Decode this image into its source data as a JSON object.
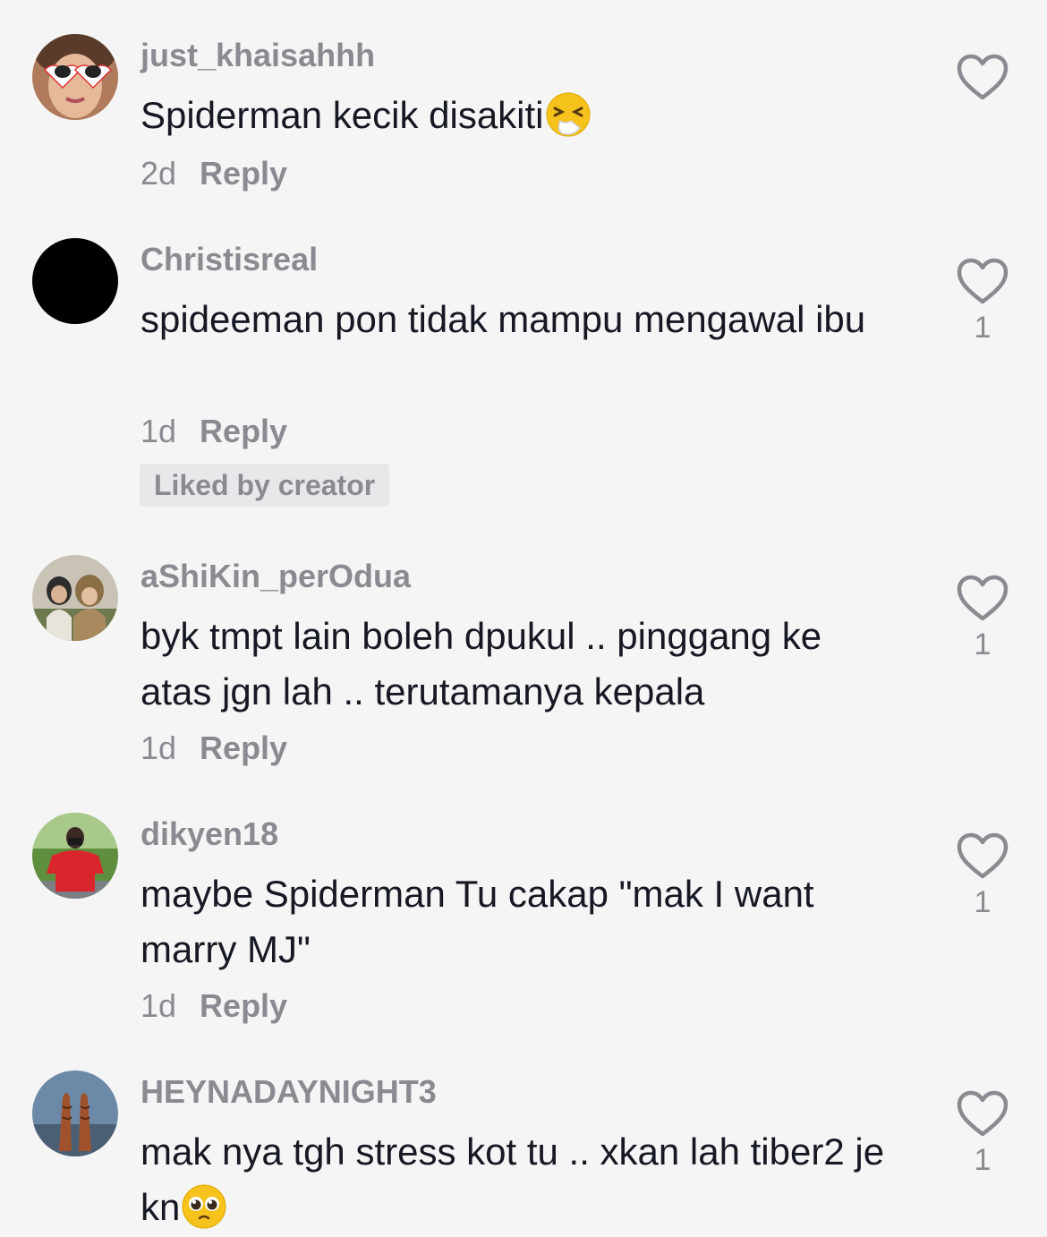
{
  "comments": [
    {
      "username": "just_khaisahhh",
      "text": "Spiderman kecik disakiti",
      "emoji": "sneezing-face-emoji",
      "time": "2d",
      "reply_label": "Reply",
      "like_count": "",
      "avatar_icon": "avatar-heart-sunglasses"
    },
    {
      "username": "Christisreal",
      "text": "spideeman pon tidak mampu mengawal ibu",
      "emoji": "",
      "time": "1d",
      "reply_label": "Reply",
      "like_count": "1",
      "liked_by_creator": "Liked by creator",
      "avatar_icon": "avatar-black-circle"
    },
    {
      "username": "aShiKin_perOdua",
      "text": "byk tmpt lain boleh dpukul .. pinggang ke atas jgn lah .. terutamanya kepala",
      "emoji": "",
      "time": "1d",
      "reply_label": "Reply",
      "like_count": "1",
      "avatar_icon": "avatar-couple-photo"
    },
    {
      "username": "dikyen18",
      "text": "maybe Spiderman Tu cakap \"mak I want marry MJ\"",
      "emoji": "",
      "time": "1d",
      "reply_label": "Reply",
      "like_count": "1",
      "avatar_icon": "avatar-man-red-shirt"
    },
    {
      "username": "HEYNADAYNIGHT3",
      "text": "mak nya tgh stress kot tu .. xkan lah tiber2 je kn",
      "emoji": "pleading-face-emoji",
      "time": "",
      "reply_label": "",
      "like_count": "1",
      "avatar_icon": "avatar-henna-hands"
    }
  ],
  "colors": {
    "background": "#f5f5f5",
    "primary_text": "#161823",
    "secondary_text": "#8a8b91",
    "badge_background": "#e8e8ea"
  }
}
